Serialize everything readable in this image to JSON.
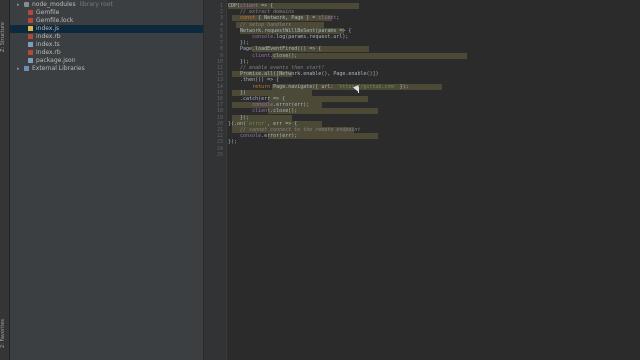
{
  "sidebar_tabs": {
    "structure": "Z: Structure",
    "favorites": "2: Favorites"
  },
  "project_tree": {
    "items": [
      {
        "label": "node_modules",
        "note": "library root",
        "icon": "folder-icon",
        "kind": "folder"
      },
      {
        "label": "Gemfile",
        "note": "",
        "icon": "file-icon",
        "kind": "rb"
      },
      {
        "label": "Gemfile.lock",
        "note": "",
        "icon": "file-icon",
        "kind": "rb"
      },
      {
        "label": "index.js",
        "note": "",
        "icon": "javascript-file-icon",
        "kind": "js",
        "selected": true
      },
      {
        "label": "index.rb",
        "note": "",
        "icon": "ruby-file-icon",
        "kind": "rb"
      },
      {
        "label": "index.ts",
        "note": "",
        "icon": "typescript-file-icon",
        "kind": "json"
      },
      {
        "label": "Index.rb",
        "note": "",
        "icon": "ruby-file-icon",
        "kind": "rb"
      },
      {
        "label": "package.json",
        "note": "",
        "icon": "json-file-icon",
        "kind": "json"
      },
      {
        "label": "External Libraries",
        "note": "",
        "icon": "library-icon",
        "kind": "lib"
      }
    ]
  },
  "editor": {
    "line_numbers": [
      "1",
      "2",
      "3",
      "4",
      "5",
      "6",
      "7",
      "8",
      "9",
      "10",
      "11",
      "12",
      "13",
      "14",
      "15",
      "16",
      "17",
      "18",
      "19",
      "20",
      "21",
      "22",
      "23",
      "24",
      "25"
    ],
    "lines": [
      "CDP(client => {",
      "    // extract domains",
      "    const { Network, Page } = client;",
      "    // setup handlers",
      "    Network.requestWillBeSent(params => {",
      "        console.log(params.request.url);",
      "    });",
      "    Page.loadEventFired(() => {",
      "        client.close();",
      "    });",
      "    // enable events then start!",
      "    Promise.all([Network.enable(), Page.enable()])",
      "    .then(() => {",
      "        return Page.navigate({ url: 'https://github.com' });",
      "    })",
      "    .catch(err => {",
      "        console.error(err);",
      "        client.close();",
      "    });",
      "}).on('error', err => {",
      "    // cannot connect to the remote endpoint",
      "    console.error(err);",
      "});",
      "",
      ""
    ]
  },
  "colors": {
    "background": "#2b2b2b",
    "project_panel": "#3c3f41",
    "selection": "#0d293e",
    "highlight": "#52503a"
  }
}
